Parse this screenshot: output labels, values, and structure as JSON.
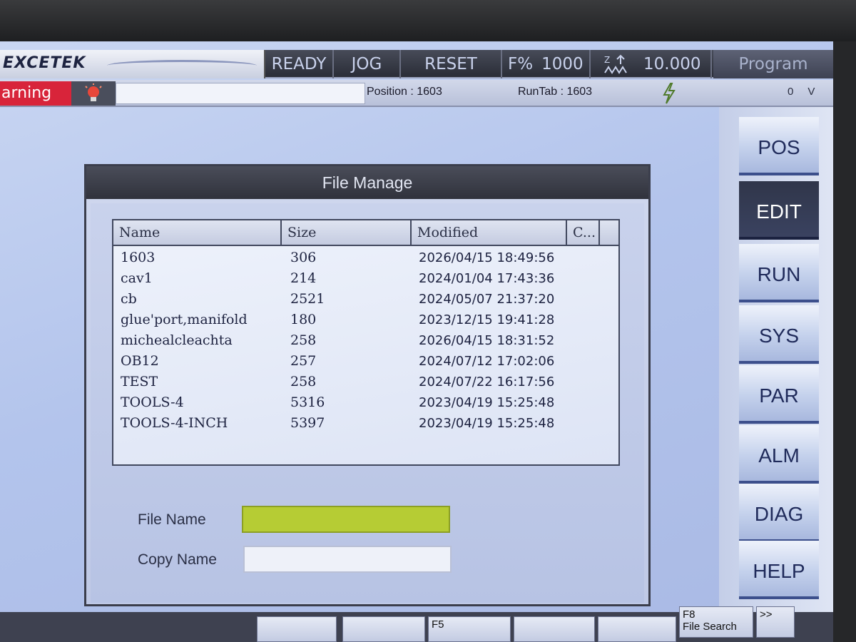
{
  "topbar": {
    "logo": "EXCETEK",
    "status_ready": "READY",
    "mode": "JOG",
    "reset": "RESET",
    "feed_label": "F%",
    "feed_value": "1000",
    "z_value": "10.000",
    "program": "Program"
  },
  "statusbar": {
    "warning": "arning",
    "position": "Position : 1603",
    "runtab": "RunTab : 1603",
    "counter": "0",
    "unit": "V"
  },
  "side_buttons": [
    "POS",
    "EDIT",
    "RUN",
    "SYS",
    "PAR",
    "ALM",
    "DIAG",
    "HELP"
  ],
  "side_active": "EDIT",
  "dialog": {
    "title": "File Manage",
    "columns": [
      "Name",
      "Size",
      "Modified",
      "C..."
    ],
    "files": [
      {
        "name": "1603",
        "size": "306",
        "modified": "2026/04/15 18:49:56"
      },
      {
        "name": "cav1",
        "size": "214",
        "modified": "2024/01/04 17:43:36"
      },
      {
        "name": "cb",
        "size": "2521",
        "modified": "2024/05/07 21:37:20"
      },
      {
        "name": "glue'port,manifold",
        "size": "180",
        "modified": "2023/12/15 19:41:28"
      },
      {
        "name": "michealcleachta",
        "size": "258",
        "modified": "2026/04/15 18:31:52"
      },
      {
        "name": "OB12",
        "size": "257",
        "modified": "2024/07/12 17:02:06"
      },
      {
        "name": "TEST",
        "size": "258",
        "modified": "2024/07/22 16:17:56"
      },
      {
        "name": "TOOLS-4",
        "size": "5316",
        "modified": "2023/04/19 15:25:48"
      },
      {
        "name": "TOOLS-4-INCH",
        "size": "5397",
        "modified": "2023/04/19 15:25:48"
      }
    ],
    "file_name_label": "File Name",
    "file_name_value": "",
    "copy_name_label": "Copy Name",
    "copy_name_value": ""
  },
  "fkeys": {
    "f5": "F5",
    "f8": "F8",
    "f8_label": "File Search",
    "more": ">>"
  },
  "colors": {
    "warning_bg": "#d8243a",
    "file_name_field": "#b6cc34",
    "edit_active": "#30364a"
  }
}
